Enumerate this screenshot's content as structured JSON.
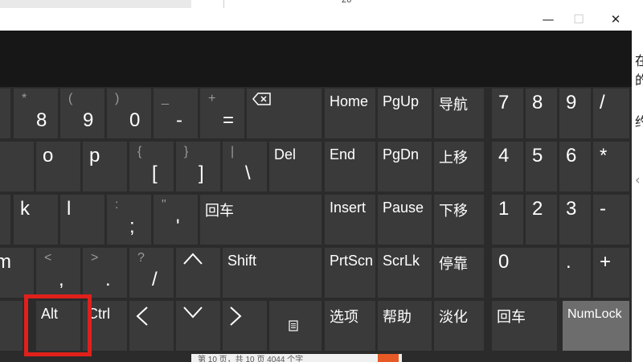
{
  "background": {
    "top_digit": "26",
    "status_text": "第 10 页，共 10 页 4044 个字",
    "right_edge_chars": [
      "在",
      "的",
      "约",
      "‹"
    ]
  },
  "window_controls": {
    "minimize": "—",
    "maximize": "☐",
    "close": "✕"
  },
  "colors": {
    "key_bg": "#3a3a3a",
    "window_bg": "#2b2b2b",
    "banner_bg": "#171717",
    "active_key_bg": "#6d6d6d",
    "highlight": "#e0201b"
  },
  "main_keys": {
    "row1": [
      {
        "top": "*",
        "bottom": "8"
      },
      {
        "top": "(",
        "bottom": "9"
      },
      {
        "top": ")",
        "bottom": "0"
      },
      {
        "top": "_",
        "bottom": "-"
      },
      {
        "top": "+",
        "bottom": "="
      }
    ],
    "backspace_icon": "backspace-icon",
    "row2": {
      "o": "o",
      "p": "p",
      "brace_open": {
        "top": "{",
        "bottom": "["
      },
      "brace_close": {
        "top": "}",
        "bottom": "]"
      },
      "pipe": {
        "top": "|",
        "bottom": "\\"
      },
      "del": "Del"
    },
    "row3": {
      "k": "k",
      "l": "l",
      "colon": {
        "top": ":",
        "bottom": ";"
      },
      "quote": {
        "top": "\"",
        "bottom": "'"
      },
      "enter": "回车"
    },
    "row4": {
      "m": "m",
      "lt": {
        "top": "<",
        "bottom": ","
      },
      "gt": {
        "top": ">",
        "bottom": "."
      },
      "question": {
        "top": "?",
        "bottom": "/"
      },
      "up_arrow": "^",
      "shift": "Shift"
    },
    "row5": {
      "alt": "Alt",
      "ctrl": "Ctrl",
      "left": "<",
      "down": "v",
      "right": ">",
      "menu_icon": "menu-icon"
    }
  },
  "nav_keys": {
    "home": "Home",
    "pgup": "PgUp",
    "nav": "导航",
    "end": "End",
    "pgdn": "PgDn",
    "move_up": "上移",
    "insert": "Insert",
    "pause": "Pause",
    "move_down": "下移",
    "prtscn": "PrtScn",
    "scrlk": "ScrLk",
    "dock": "停靠",
    "options": "选项",
    "help": "帮助",
    "fade": "淡化"
  },
  "numpad": {
    "row1": [
      "7",
      "8",
      "9",
      "/"
    ],
    "row2": [
      "4",
      "5",
      "6",
      "*"
    ],
    "row3": [
      "1",
      "2",
      "3",
      "-"
    ],
    "row4": {
      "zero": "0",
      "dot": ".",
      "plus": "+"
    },
    "enter": "回车",
    "numlock": "NumLock"
  }
}
